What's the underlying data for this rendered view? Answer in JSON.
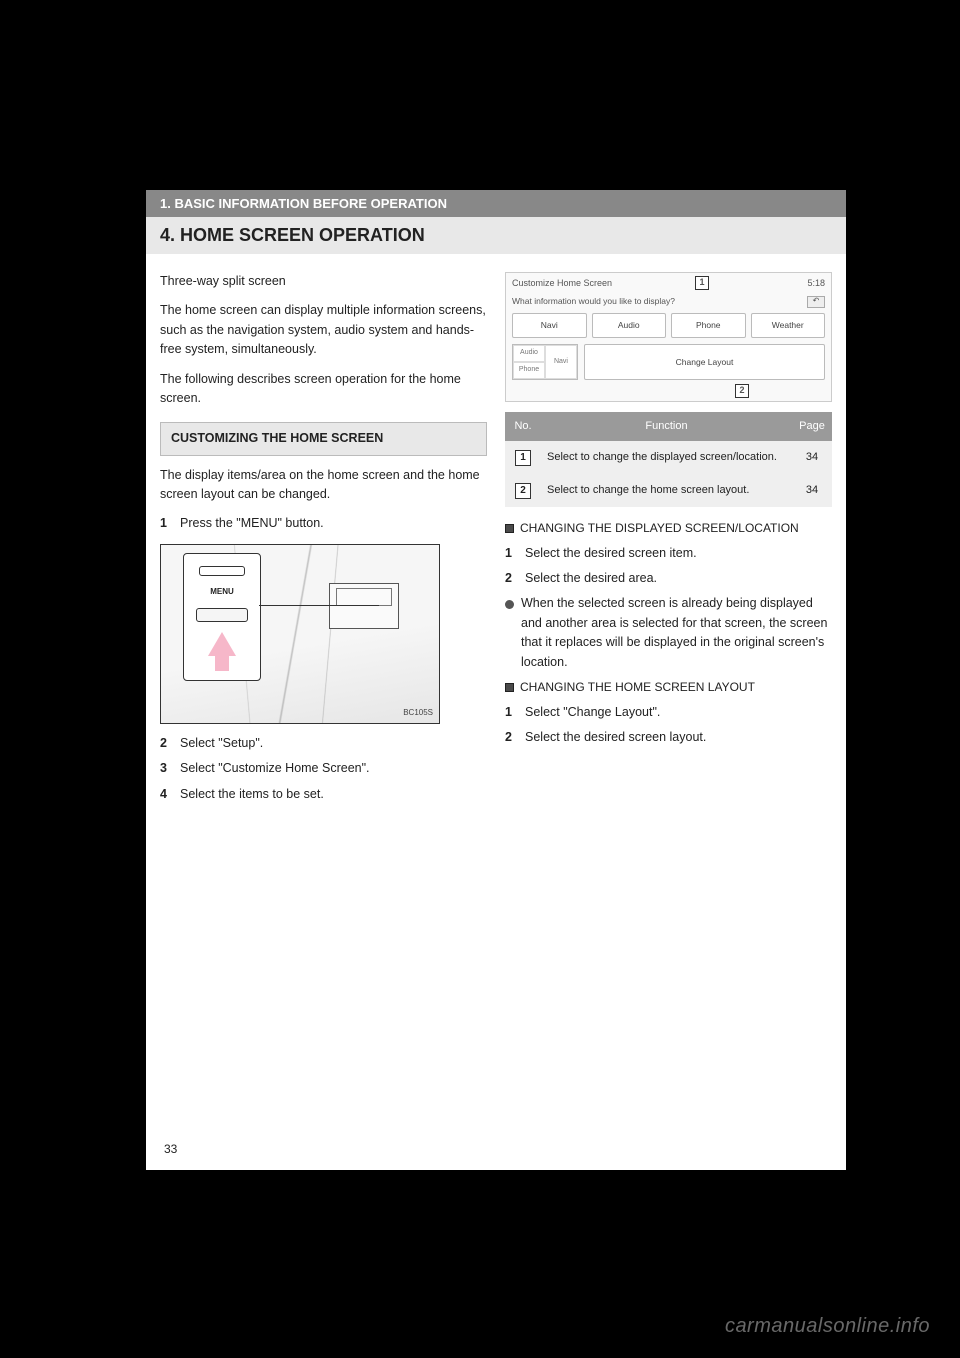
{
  "header": {
    "chapter": "1. BASIC INFORMATION BEFORE OPERATION",
    "title": "4. HOME SCREEN OPERATION"
  },
  "left": {
    "intro1": "Three-way split screen",
    "intro2": "The home screen can display multiple information screens, such as the navigation system, audio system and hands-free system, simultaneously.",
    "intro3": "The following describes screen operation for the home screen.",
    "sub_heading": "CUSTOMIZING THE HOME SCREEN",
    "sub_desc": "The display items/area on the home screen and the home screen layout can be changed.",
    "step1_num": "1",
    "step1_text": "Press the \"MENU\" button.",
    "dash_label": "MENU",
    "dash_id": "BC105S",
    "step2_num": "2",
    "step2_text": "Select \"Setup\".",
    "step3_num": "3",
    "step3_text": "Select \"Customize Home Screen\".",
    "step4_num": "4",
    "step4_text": "Select the items to be set."
  },
  "right": {
    "ui": {
      "title": "Customize Home Screen",
      "time": "5:18",
      "prompt": "What information would you like to display?",
      "btn_back_icon": "arrow_return",
      "btn_navi": "Navi",
      "btn_audio": "Audio",
      "btn_phone": "Phone",
      "btn_weather": "Weather",
      "mini_audio": "Audio",
      "mini_phone": "Phone",
      "mini_navi": "Navi",
      "change_layout": "Change Layout",
      "callout1": "1",
      "callout2": "2"
    },
    "table": {
      "h_no": "No.",
      "h_func": "Function",
      "h_page": "Page",
      "r1_num": "1",
      "r1_func": "Select to change the displayed screen/location.",
      "r1_page": "34",
      "r2_num": "2",
      "r2_func": "Select to change the home screen layout.",
      "r2_page": "34"
    },
    "proc1_head": "CHANGING THE DISPLAYED SCREEN/LOCATION",
    "proc1_step1_num": "1",
    "proc1_step1": "Select the desired screen item.",
    "proc1_step2_num": "2",
    "proc1_step2": "Select the desired area.",
    "proc1_note": "When the selected screen is already being displayed and another area is selected for that screen, the screen that it replaces will be displayed in the original screen's location.",
    "proc2_head": "CHANGING THE HOME SCREEN LAYOUT",
    "proc2_step1_num": "1",
    "proc2_step1": "Select \"Change Layout\".",
    "proc2_step2_num": "2",
    "proc2_step2": "Select the desired screen layout."
  },
  "page_number": "33",
  "watermark": "carmanualsonline.info"
}
